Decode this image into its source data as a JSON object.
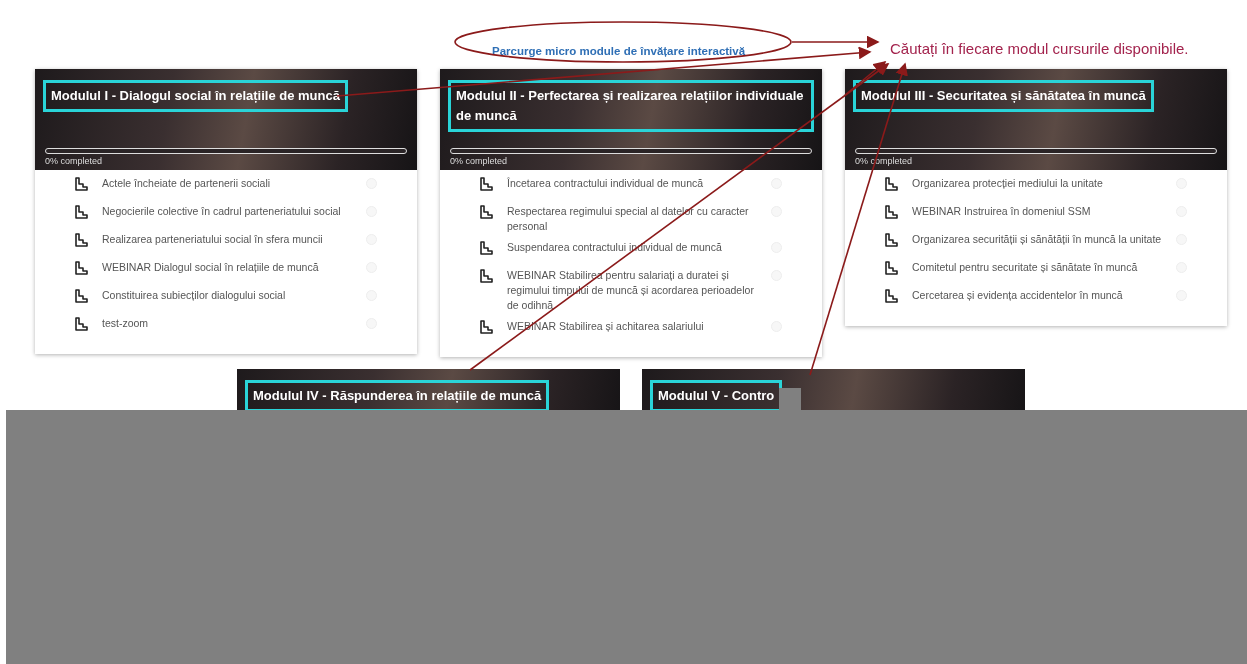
{
  "callout": {
    "label": "Parcurge micro module de învățare interactivă"
  },
  "annotation": {
    "label": "Căutați în fiecare modul cursurile disponibile."
  },
  "modules": [
    {
      "title": "Modulul I - Dialogul social în relațiile de muncă",
      "progress": {
        "level": 0,
        "label": "0% completed"
      },
      "items": [
        "Actele încheiate de partenerii sociali",
        "Negocierile colective în cadrul parteneriatului social",
        "Realizarea parteneriatului social în sfera muncii",
        "WEBINAR Dialogul social în relațiile de muncă",
        "Constituirea subiecților dialogului social",
        "test-zoom"
      ]
    },
    {
      "title": "Modulul II - Perfectarea și realizarea relațiilor individuale de muncă",
      "progress": {
        "level": 0,
        "label": "0% completed"
      },
      "items": [
        "Încetarea contractului individual de muncă",
        "Respectarea regimului special al datelor cu caracter personal",
        "Suspendarea contractului individual de muncă",
        "WEBINAR Stabilirea pentru salariați a duratei și regimului timpului de muncă și acordarea perioadelor de odihnă",
        "WEBINAR Stabilirea și achitarea salariului"
      ]
    },
    {
      "title": "Modulul III - Securitatea și sănătatea în muncă",
      "progress": {
        "level": 0,
        "label": "0% completed"
      },
      "items": [
        "Organizarea protecției mediului la unitate",
        "WEBINAR Instruirea în domeniul SSM",
        "Organizarea securității și sănătății în muncă la unitate",
        "Comitetul pentru securitate și sănătate în muncă",
        "Cercetarea și evidența accidentelor în muncă"
      ]
    }
  ],
  "lower_modules": [
    {
      "title": "Modulul IV - Răspunderea în relațiile de muncă"
    },
    {
      "title": "Modulul V - Contro"
    }
  ]
}
